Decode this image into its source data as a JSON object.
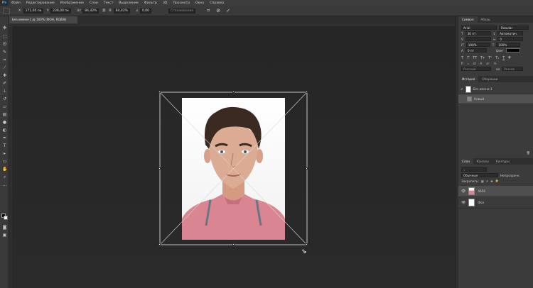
{
  "app": {
    "logo": "Ps"
  },
  "menu": [
    "Файл",
    "Редактирование",
    "Изображение",
    "Слои",
    "Текст",
    "Выделение",
    "Фильтр",
    "3D",
    "Просмотр",
    "Окно",
    "Справка"
  ],
  "options": {
    "x_label": "X:",
    "x_value": "171,00 пк",
    "y_label": "Y:",
    "y_value": "236,00 пк",
    "w_label": "Ш:",
    "w_value": "84,42%",
    "h_label": "В:",
    "h_value": "84,42%",
    "angle_label": "∠",
    "angle_value": "0,00",
    "interp_label": "Сглаживание"
  },
  "document": {
    "tab_title": "Без имени-1 @ 100% (ФОН, RGB/8)"
  },
  "character_panel": {
    "tabs": [
      "Символ",
      "Абзац"
    ],
    "font_family": "Arial",
    "font_style": "Regular",
    "size": "30 пт",
    "leading": "Автоматич.",
    "tracking": "0",
    "scale_v": "100%",
    "scale_h": "100%",
    "baseline": "0 пт",
    "color_label": "Цвет",
    "language": "Русский",
    "aa": "Резкое"
  },
  "history_panel": {
    "tabs": [
      "История",
      "Операции"
    ],
    "items": [
      "Без имени-1",
      "Новый"
    ]
  },
  "layers_panel": {
    "tabs": [
      "Слои",
      "Каналы",
      "Контуры"
    ],
    "blend_mode": "Обычные",
    "opacity_label": "Непрозрачн.",
    "lock_label": "Закрепить:",
    "layers": [
      {
        "name": "4656",
        "kind": "photo"
      },
      {
        "name": "Фон",
        "kind": "background"
      }
    ]
  },
  "colors": {
    "accent": "#2fa3f7",
    "shirt": "#d98592",
    "hair": "#3b2a22",
    "skin": "#d9a88f"
  }
}
